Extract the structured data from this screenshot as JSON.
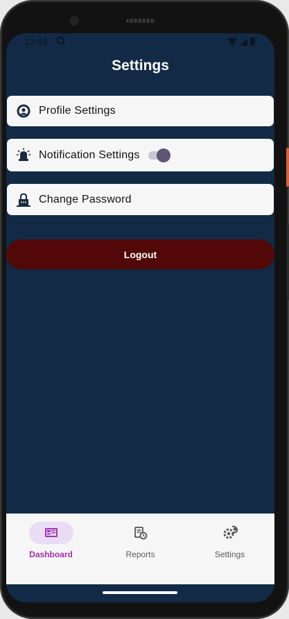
{
  "status_bar": {
    "time": "12:48"
  },
  "header": {
    "title": "Settings"
  },
  "settings_items": [
    {
      "label": "Profile Settings",
      "icon": "profile-icon"
    },
    {
      "label": "Notification Settings",
      "icon": "alarm-bell-icon",
      "toggle_on": true
    },
    {
      "label": "Change Password",
      "icon": "lock-icon"
    }
  ],
  "logout": {
    "label": "Logout"
  },
  "bottom_nav": {
    "items": [
      {
        "label": "Dashboard",
        "icon": "dashboard-icon",
        "active": true
      },
      {
        "label": "Reports",
        "icon": "reports-icon",
        "active": false
      },
      {
        "label": "Settings",
        "icon": "settings-gear-icon",
        "active": false
      }
    ]
  },
  "colors": {
    "screen_bg": "#132a46",
    "card_bg": "#f6f6f6",
    "logout_bg": "#520808",
    "active_nav": "#9c2fa6",
    "active_pill": "#eadcf4"
  }
}
